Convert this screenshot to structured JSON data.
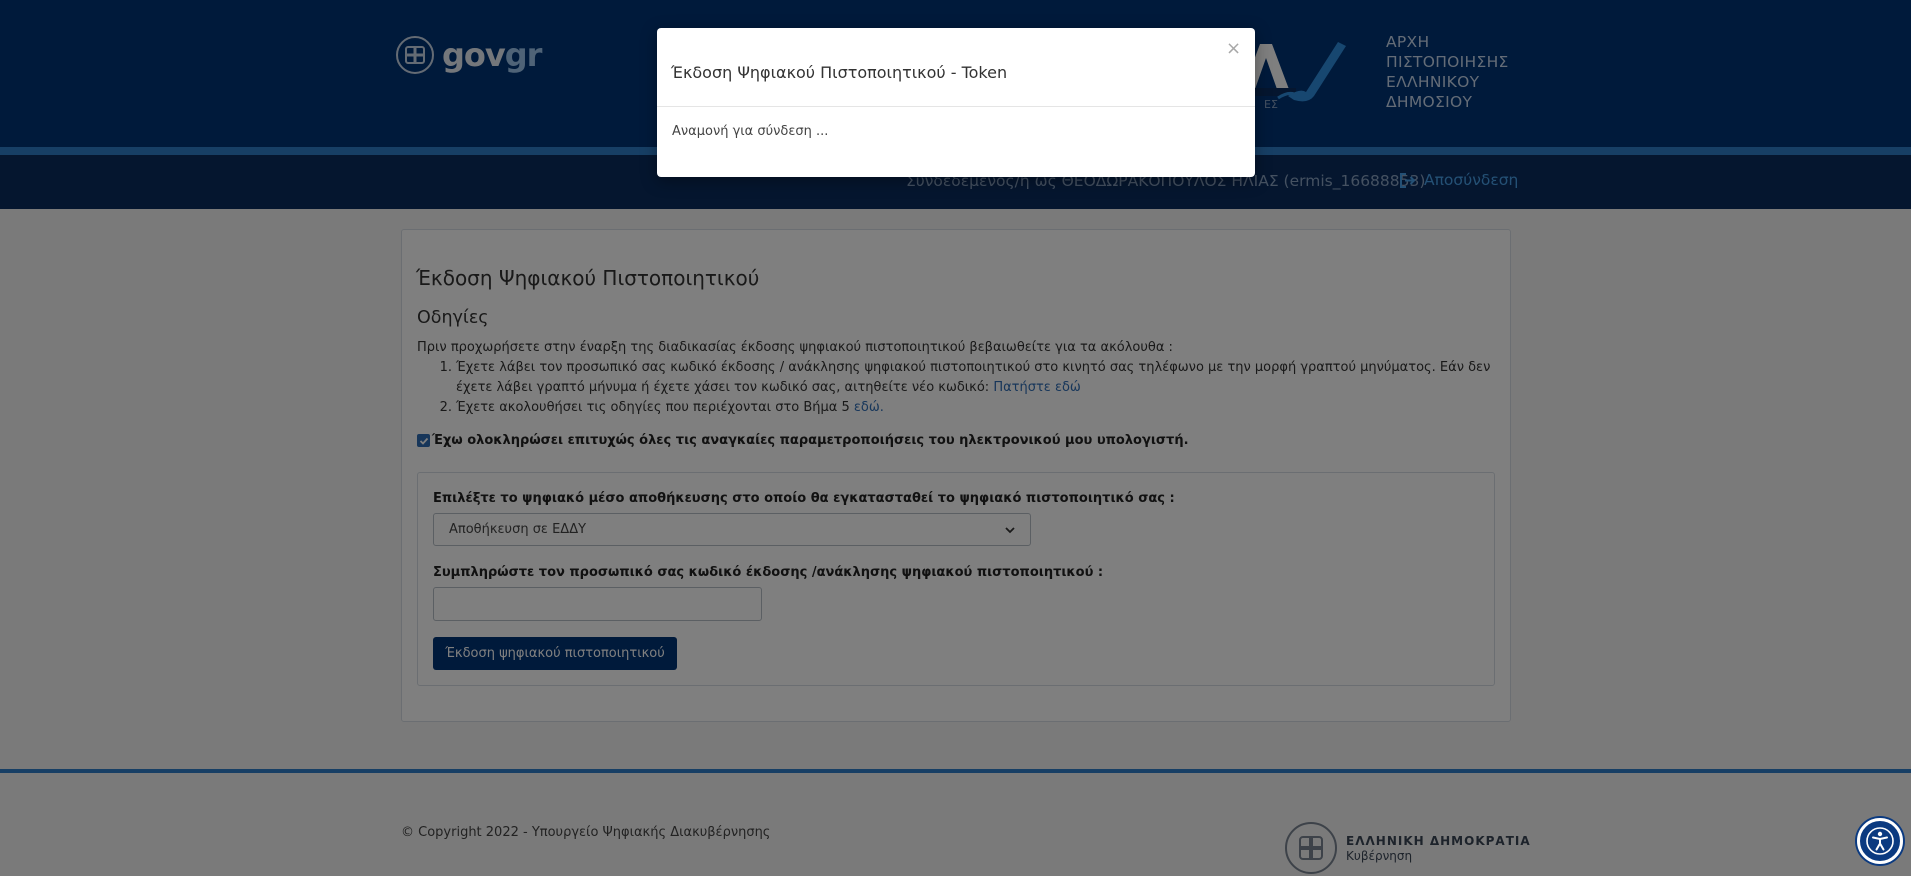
{
  "header": {
    "logo_text_gov": "gov",
    "logo_text_gr": "gr",
    "authority_lines": [
      "ΑΡΧΗ",
      "ΠΙΣΤΟΠΟΙΗΣΗΣ",
      "ΕΛΛΗΝΙΚΟΥ",
      "ΔΗΜΟΣΙΟΥ"
    ],
    "user_line": "Συνδεδεμένος/η ως ΘΕΟΔΩΡΑΚΟΠΟΥΛΟΣ ΗΛΙΑΣ (ermis_16688853)",
    "logout_label": "Αποσύνδεση"
  },
  "main": {
    "title": "Έκδοση Ψηφιακού Πιστοποιητικού",
    "instructions_heading": "Οδηγίες",
    "intro": "Πριν προχωρήσετε στην έναρξη της διαδικασίας έκδοσης ψηφιακού πιστοποιητικού βεβαιωθείτε για τα ακόλουθα :",
    "steps": [
      {
        "number": "1.",
        "text": "Έχετε λάβει τον προσωπικό σας κωδικό έκδοσης / ανάκλησης ψηφιακού πιστοποιητικού στο κινητό σας τηλέφωνο με την μορφή γραπτού μηνύματος. Εάν δεν έχετε λάβει γραπτό μήνυμα ή έχετε χάσει τον κωδικό σας, αιτηθείτε νέο κωδικό: ",
        "link": "Πατήστε εδώ"
      },
      {
        "number": "2.",
        "text": "Έχετε ακολουθήσει τις οδηγίες που περιέχονται στο Βήμα 5 ",
        "link": "εδώ."
      }
    ],
    "checkbox_label": "Έχω ολοκληρώσει επιτυχώς όλες τις αναγκαίες παραμετροποιήσεις του ηλεκτρονικού μου υπολογιστή.",
    "checkbox_checked": true,
    "storage_label": "Επιλέξτε το ψηφιακό μέσο αποθήκευσης στο οποίο θα εγκατασταθεί το ψηφιακό πιστοποιητικό σας :",
    "storage_selected": "Αποθήκευση σε ΕΔΔΥ",
    "code_label": "Συμπληρώστε τον προσωπικό σας κωδικό έκδοσης /ανάκλησης ψηφιακού πιστοποιητικού :",
    "code_value": "",
    "submit_label": "Έκδοση ψηφιακού πιστοποιητικού"
  },
  "footer": {
    "copyright": "© Copyright 2022 - Υπουργείο Ψηφιακής Διακυβέρνησης",
    "gov_name": "ΕΛΛΗΝΙΚΗ ΔΗΜΟΚΡΑΤΙΑ",
    "gov_sub": "Κυβέρνηση"
  },
  "modal": {
    "title": "Έκδοση Ψηφιακού Πιστοποιητικού - Token",
    "close_glyph": "×",
    "body": "Αναμονή για σύνδεση ..."
  },
  "colors": {
    "header_blue": "#003476",
    "stripe_blue": "#2f7fca",
    "link_blue": "#2f6db5",
    "button_blue": "#003476"
  },
  "icons": [
    "greek-emblem-icon",
    "ada-pen-icon",
    "logout-icon",
    "chevron-down-icon",
    "checkmark-icon",
    "accessibility-icon",
    "close-icon"
  ]
}
